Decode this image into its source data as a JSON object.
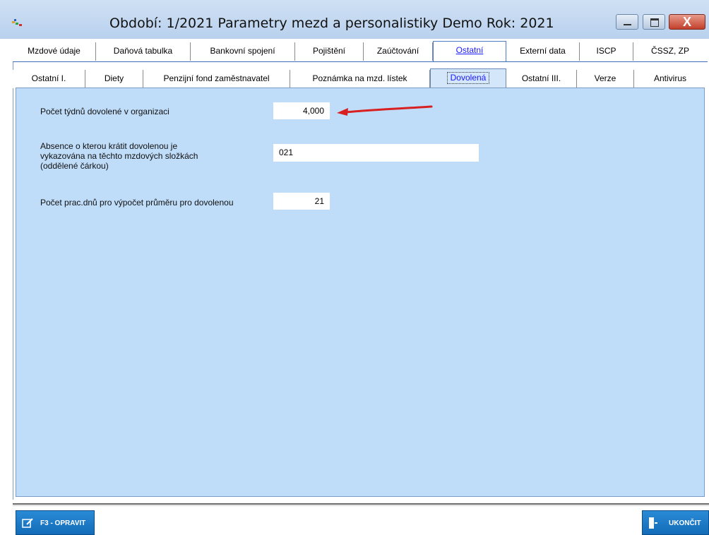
{
  "window": {
    "title": "Období: 1/2021 Parametry mezd a personalistiky  Demo  Rok: 2021",
    "close_glyph": "X"
  },
  "tabs_main": [
    {
      "label": "Mzdové údaje"
    },
    {
      "label": "Daňová tabulka"
    },
    {
      "label": "Bankovní spojení"
    },
    {
      "label": "Pojištění"
    },
    {
      "label": "Zaúčtování"
    },
    {
      "label": "Ostatní",
      "active": true
    },
    {
      "label": "Externí data"
    },
    {
      "label": "ISCP"
    },
    {
      "label": "ČSSZ, ZP"
    }
  ],
  "tabs_sub": [
    {
      "label": "Ostatní I."
    },
    {
      "label": "Diety"
    },
    {
      "label": "Penzijní fond zaměstnavatel"
    },
    {
      "label": "Poznámka na mzd. lístek"
    },
    {
      "label": "Dovolená",
      "active": true
    },
    {
      "label": "Ostatní III."
    },
    {
      "label": "Verze"
    },
    {
      "label": "Antivirus"
    }
  ],
  "form": {
    "weeks_label": "Počet týdnů dovolené v organizaci",
    "weeks_value": "4,000",
    "absence_label_1": "Absence o kterou krátit dovolenou je",
    "absence_label_2": "vykazována na těchto mzdových složkách",
    "absence_label_3": "(oddělené čárkou)",
    "absence_value": "021",
    "days_label": "Počet prac.dnů pro výpočet průměru pro dovolenou",
    "days_value": "21"
  },
  "buttons": {
    "edit_label": "F3 - OPRAVIT",
    "exit_label": "UKONČIT"
  },
  "colors": {
    "panel_bg": "#bfdcf8",
    "accent_arrow": "#d92020",
    "button_blue": "#1f7cc8"
  }
}
